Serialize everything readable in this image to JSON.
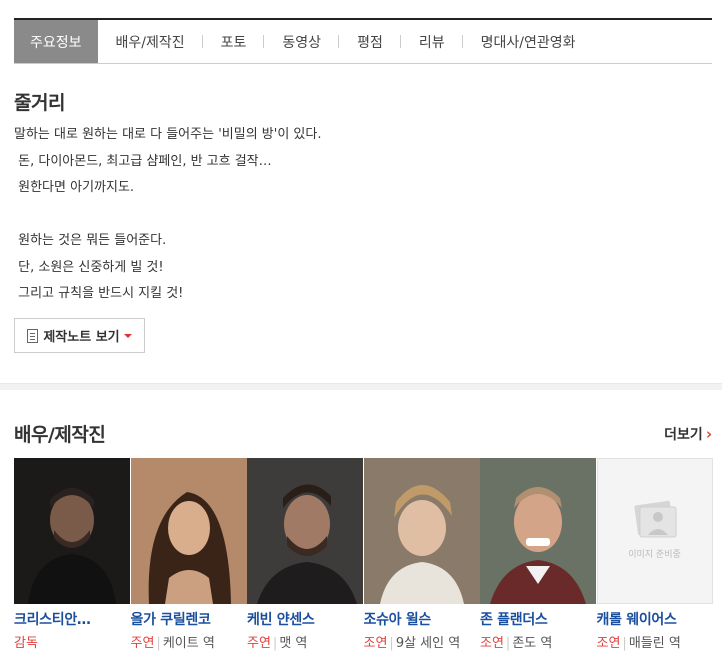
{
  "tabs": [
    {
      "label": "주요정보",
      "active": true
    },
    {
      "label": "배우/제작진",
      "active": false
    },
    {
      "label": "포토",
      "active": false
    },
    {
      "label": "동영상",
      "active": false
    },
    {
      "label": "평점",
      "active": false
    },
    {
      "label": "리뷰",
      "active": false
    },
    {
      "label": "명대사/연관영화",
      "active": false
    }
  ],
  "synopsis": {
    "title": "줄거리",
    "lines": [
      "말하는 대로 원하는 대로 다 들어주는 '비밀의 방'이 있다.",
      " 돈, 다이아몬드, 최고급 샴페인, 반 고흐 걸작…",
      " 원한다면 아기까지도.",
      "",
      " 원하는 것은 뭐든 들어준다.",
      " 단, 소원은 신중하게 빌 것!",
      " 그리고 규칙을 반드시 지킬 것!"
    ],
    "note_button": "제작노트 보기"
  },
  "cast_section": {
    "title": "배우/제작진",
    "more_label": "더보기",
    "people": [
      {
        "name": "크리스티안…",
        "type": "감독",
        "character": ""
      },
      {
        "name": "올가 쿠릴렌코",
        "type": "주연",
        "character": "케이트 역"
      },
      {
        "name": "케빈 얀센스",
        "type": "주연",
        "character": "맷 역"
      },
      {
        "name": "조슈아 윌슨",
        "type": "조연",
        "character": "9살 세인 역"
      },
      {
        "name": "존 플랜더스",
        "type": "조연",
        "character": "존도 역"
      },
      {
        "name": "캐롤 웨이어스",
        "type": "조연",
        "character": "매들린 역"
      }
    ],
    "placeholder_label": "이미지 준비중"
  }
}
